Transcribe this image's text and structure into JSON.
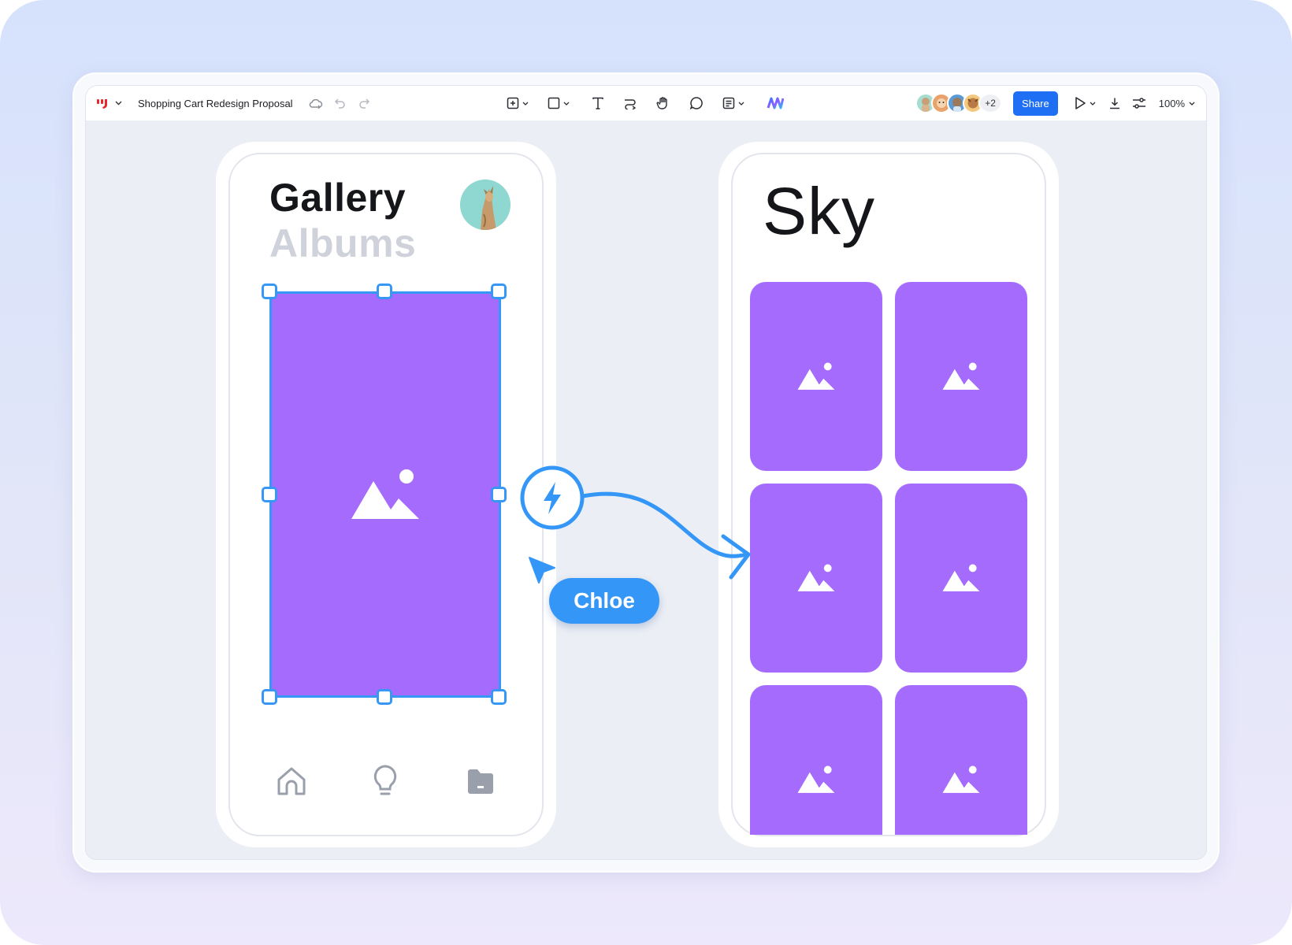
{
  "app": {
    "document_title": "Shopping Cart Redesign Proposal",
    "share_label": "Share",
    "zoom_label": "100%",
    "collaborators_extra": "+2",
    "brand_color": "#e8272c",
    "accent_color": "#1e6ff3"
  },
  "toolbar_tools": [
    "insert-frame-tool",
    "shape-tool",
    "text-tool",
    "connector-tool",
    "hand-tool",
    "comment-tool",
    "sticky-note-tool",
    "ai-tool"
  ],
  "canvas": {
    "left_screen": {
      "title": "Gallery",
      "subtitle": "Albums",
      "bottom_nav": [
        "home-icon",
        "lightbulb-icon",
        "folder-icon"
      ]
    },
    "right_screen": {
      "title": "Sky",
      "tiles": 6
    },
    "prototype_link": "lightning-icon",
    "cursor_user": "Chloe",
    "selection_color": "#3797f5",
    "image_placeholder_color": "#a56bfd"
  }
}
